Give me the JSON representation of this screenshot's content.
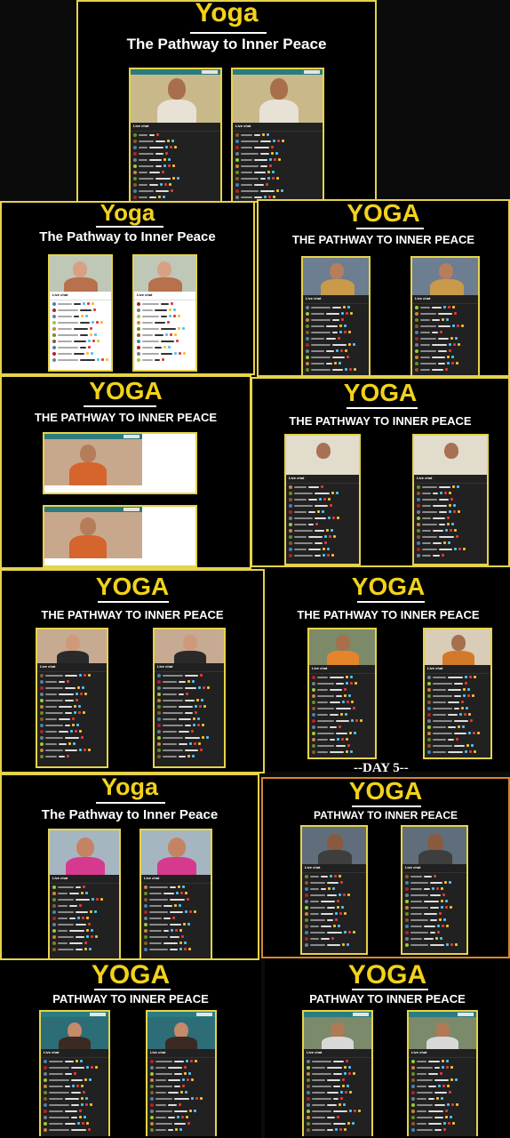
{
  "panels": [
    {
      "title": "Yoga",
      "subtitle": "The Pathway to Inner Peace"
    },
    {
      "title": "Yoga",
      "subtitle": "The Pathway to Inner Peace"
    },
    {
      "title": "YOGA",
      "subtitle": "THE PATHWAY TO INNER PEACE"
    },
    {
      "title": "YOGA",
      "subtitle": "THE PATHWAY TO INNER PEACE"
    },
    {
      "title": "YOGA",
      "subtitle": "THE PATHWAY TO INNER PEACE"
    },
    {
      "title": "YOGA",
      "subtitle": "THE PATHWAY TO INNER PEACE"
    },
    {
      "title": "YOGA",
      "subtitle": "THE PATHWAY TO INNER PEACE"
    },
    {
      "title": "Yoga",
      "subtitle": "The Pathway to Inner Peace"
    },
    {
      "title": "YOGA",
      "subtitle": "PATHWAY TO  INNER PEACE"
    },
    {
      "title": "YOGA",
      "subtitle": "PATHWAY TO  INNER PEACE"
    },
    {
      "title": "YOGA",
      "subtitle": "PATHWAY TO  INNER PEACE"
    }
  ],
  "day_label": "--DAY 5--",
  "chat_title": "Live chat",
  "colors": {
    "accent": "#f2d21b",
    "frame": "#e6d34a",
    "chat_bg": "#212121"
  }
}
